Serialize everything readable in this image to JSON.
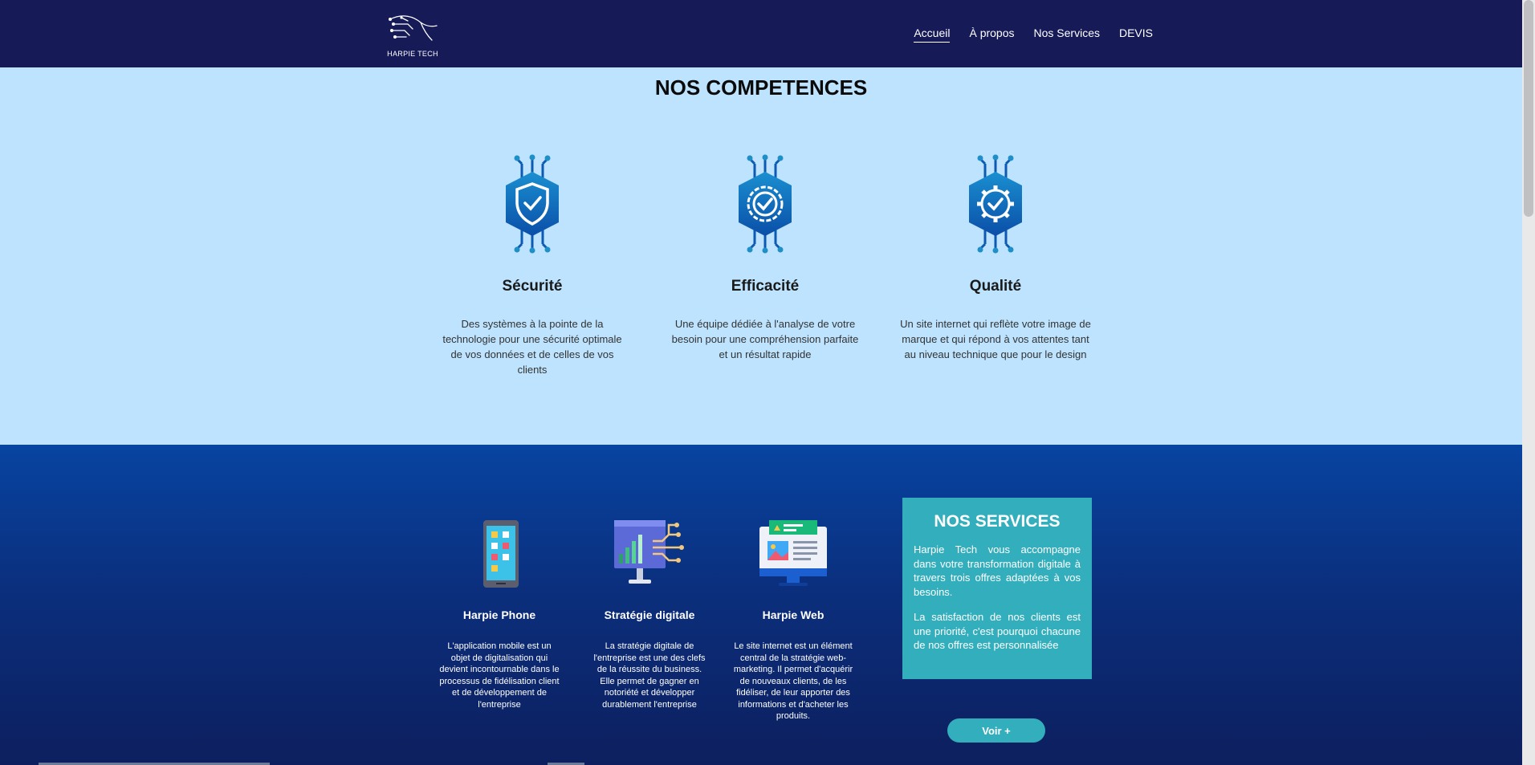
{
  "header": {
    "logo_text": "HARPIE TECH",
    "nav": [
      "Accueil",
      "À propos",
      "Nos Services",
      "DEVIS"
    ],
    "active_index": 0
  },
  "competences": {
    "title": "NOS COMPETENCES",
    "cards": [
      {
        "icon": "shield-check-icon",
        "title": "Sécurité",
        "text": "Des systèmes à la pointe de la technologie pour une sécurité optimale de vos données et de celles de vos clients"
      },
      {
        "icon": "badge-check-icon",
        "title": "Efficacité",
        "text": "Une équipe dédiée à l'analyse de votre besoin pour une compréhension parfaite et un résultat rapide"
      },
      {
        "icon": "gear-check-icon",
        "title": "Qualité",
        "text": "Un site internet qui reflète votre image de marque et qui répond à vos attentes tant au niveau technique que pour le design"
      }
    ]
  },
  "services": {
    "cards": [
      {
        "icon": "smartphone-icon",
        "title": "Harpie Phone",
        "text": "L'application mobile est un objet de digitalisation qui devient incontournable dans le processus de fidélisation client et de développement de l'entreprise"
      },
      {
        "icon": "strategy-monitor-icon",
        "title": "Stratégie digitale",
        "text": "La stratégie digitale de l'entreprise est une des clefs de la réussite du business. Elle permet de gagner en notoriété et développer durablement l'entreprise"
      },
      {
        "icon": "web-monitor-icon",
        "title": "Harpie Web",
        "text": "Le site internet est un élément central de la stratégie web-marketing. Il permet d'acquérir de nouveaux clients, de les fidéliser, de leur apporter des informations et d'acheter les produits."
      }
    ],
    "box": {
      "title": "NOS SERVICES",
      "paragraph1": "Harpie Tech vous accompagne dans votre transformation digitale à travers trois offres adaptées à vos besoins.",
      "paragraph2": "La satisfaction de nos clients est une priorité, c'est pourquoi chacune de nos offres est personnalisée"
    },
    "button_label": "Voir +"
  },
  "colors": {
    "header_bg": "#161b58",
    "competences_bg": "#bde3fe",
    "accent": "#33aebc",
    "icon_blue": "#0c5ab3"
  }
}
